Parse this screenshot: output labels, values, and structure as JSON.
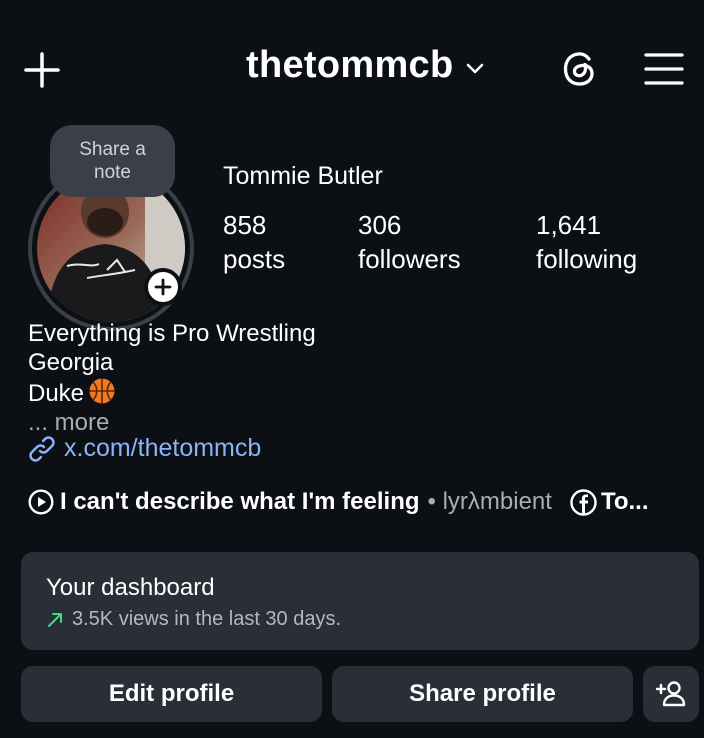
{
  "header": {
    "username": "thetommcb"
  },
  "profile": {
    "note_label": "Share a note",
    "full_name": "Tommie Butler",
    "stats": [
      {
        "value": "858",
        "label": "posts"
      },
      {
        "value": "306",
        "label": "followers"
      },
      {
        "value": "1,641",
        "label": "following"
      }
    ],
    "bio_lines": [
      "Everything is Pro Wrestling",
      "Georgia",
      "Duke"
    ],
    "bio_more": "... more",
    "link": "x.com/thetommcb"
  },
  "music": {
    "song": "I can't describe what I'm feeling",
    "artist": "• lyrλmbient",
    "facebook_label": "To..."
  },
  "dashboard": {
    "title": "Your dashboard",
    "subtitle": "3.5K views in the last 30 days.",
    "trend_color": "#3ddc84"
  },
  "actions": {
    "edit_label": "Edit profile",
    "share_label": "Share profile"
  },
  "icons": {
    "new_post": "plus-icon",
    "account_switch": "chevron-down-icon",
    "threads": "threads-icon",
    "menu": "hamburger-menu-icon",
    "link": "link-icon",
    "music": "play-circle-icon",
    "facebook": "facebook-icon",
    "discover_people": "add-person-icon"
  }
}
